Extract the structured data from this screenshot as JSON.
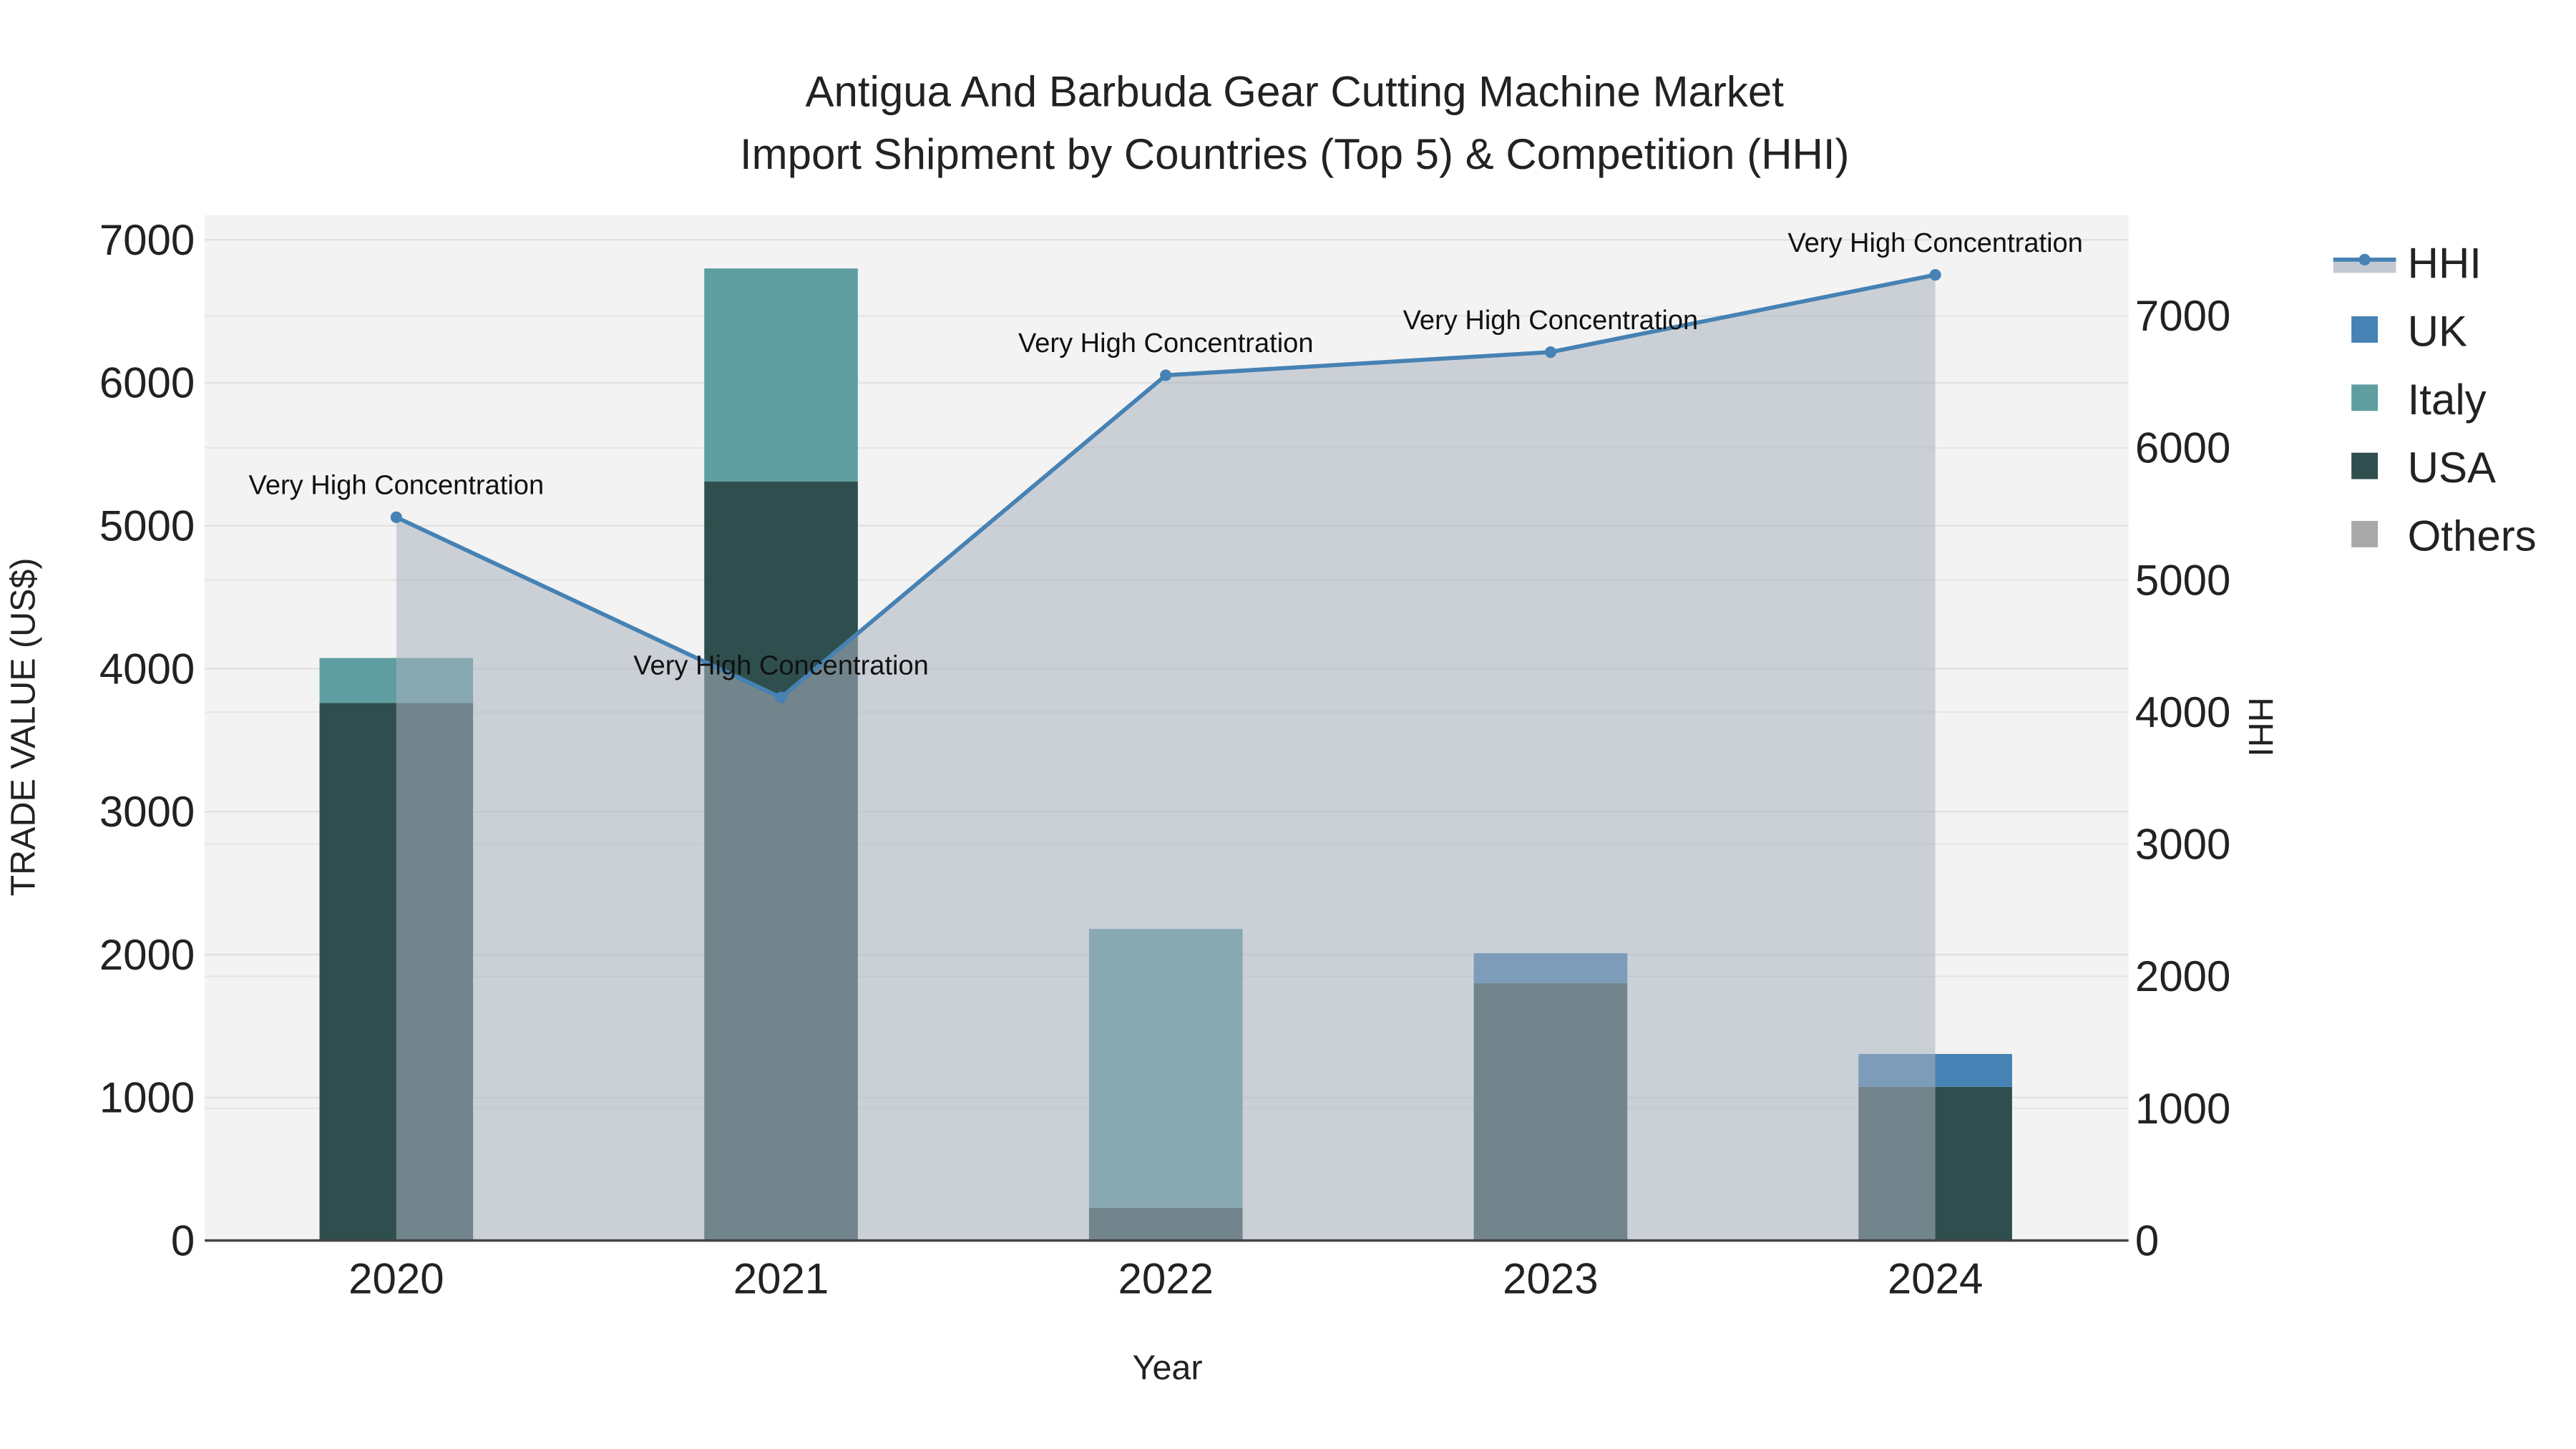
{
  "chart_data": {
    "type": "bar",
    "title_line1": "Antigua And Barbuda Gear Cutting Machine Market",
    "title_line2": "Import Shipment by Countries (Top 5) & Competition (HHI)",
    "xlabel": "Year",
    "ylabel": "TRADE VALUE (US$)",
    "y2label": "HHI",
    "categories": [
      "2020",
      "2021",
      "2022",
      "2023",
      "2024"
    ],
    "ylim": [
      0,
      7000
    ],
    "y2lim": [
      0,
      7000
    ],
    "yticks": [
      0,
      1000,
      2000,
      3000,
      4000,
      5000,
      6000,
      7000
    ],
    "y2ticks": [
      0,
      1000,
      2000,
      3000,
      4000,
      5000,
      6000,
      7000
    ],
    "legend_position": "right",
    "series": [
      {
        "name": "USA",
        "color": "#2F4F4F",
        "values": [
          3760,
          5310,
          230,
          1800,
          1075
        ]
      },
      {
        "name": "Italy",
        "color": "#5F9EA0",
        "values": [
          315,
          1490,
          1950,
          0,
          0
        ]
      },
      {
        "name": "UK",
        "color": "#4682B4",
        "values": [
          0,
          0,
          0,
          210,
          230
        ]
      },
      {
        "name": "Others",
        "color": "#A9A9A9",
        "values": [
          0,
          0,
          0,
          0,
          0
        ]
      }
    ],
    "hhi": {
      "name": "HHI",
      "color": "#4682B4",
      "values": [
        5475,
        4110,
        6550,
        6725,
        7310
      ],
      "annotations": [
        "Very High Concentration",
        "Very High Concentration",
        "Very High Concentration",
        "Very High Concentration",
        "Very High Concentration"
      ]
    },
    "legend": [
      "HHI",
      "UK",
      "Italy",
      "USA",
      "Others"
    ]
  }
}
